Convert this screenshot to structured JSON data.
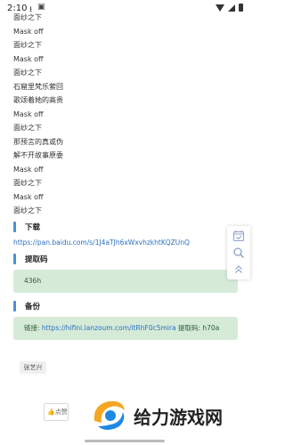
{
  "status_bar": {
    "time": "2:10"
  },
  "lyrics": [
    "面纱之下",
    "Mask off",
    "面纱之下",
    "Mask off",
    "面纱之下",
    "石窟里梵乐萦回",
    "歌颂着她的高贵",
    "Mask off",
    "面纱之下",
    "那预言的真或伪",
    "解不开故事原委",
    "Mask off",
    "面纱之下",
    "Mask off",
    "面纱之下"
  ],
  "download": {
    "heading": "下载",
    "link": "https://pan.baidu.com/s/1J4aTJh6xWxvhzkhtKQZUnQ"
  },
  "extract_code": {
    "heading": "提取码",
    "value": "436h"
  },
  "backup": {
    "heading": "备份",
    "prefix": "链接: ",
    "link": "https://hifini.lanzoum.com/itRhF0c5mira",
    "suffix": " 提取码: h70a"
  },
  "tag": "张艺兴",
  "like_button": "点赞",
  "watermark": "给力游戏网",
  "colors": {
    "accent_bar": "#4a8fd8",
    "link": "#2a6fbf",
    "code_box_bg": "#d5ebd8",
    "code_box_text": "#2e5a36",
    "watermark_orange": "#f5a623",
    "watermark_blue": "#1e88e5"
  },
  "icons": [
    "download-icon",
    "sim-icon",
    "wifi-icon",
    "signal-icon",
    "battery-icon",
    "calendar-check-icon",
    "search-icon",
    "double-chevron-up-icon",
    "thumbs-up-icon"
  ]
}
